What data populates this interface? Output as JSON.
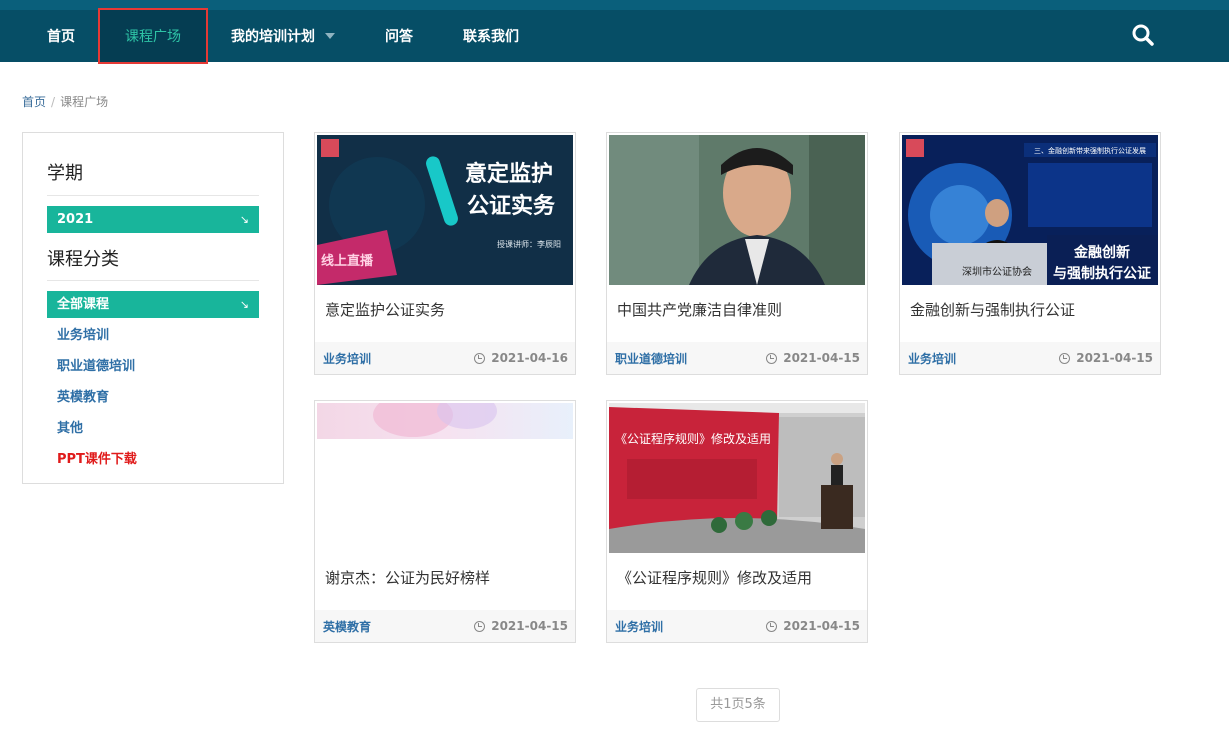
{
  "nav": {
    "items": [
      {
        "label": "首页"
      },
      {
        "label": "课程广场"
      },
      {
        "label": "我的培训计划"
      },
      {
        "label": "问答"
      },
      {
        "label": "联系我们"
      }
    ]
  },
  "breadcrumb": {
    "home": "首页",
    "current": "课程广场",
    "separator": "/"
  },
  "sidebar": {
    "term_title": "学期",
    "term_selected": "2021",
    "category_title": "课程分类",
    "category_selected": "全部课程",
    "categories": [
      "业务培训",
      "职业道德培训",
      "英模教育",
      "其他",
      "PPT课件下载"
    ]
  },
  "courses": [
    {
      "title": "意定监护公证实务",
      "category": "业务培训",
      "date": "2021-04-16",
      "thumb": {
        "headline1": "意定监护",
        "headline2": "公证实务",
        "lecturer": "授课讲师：李辰阳",
        "badge": "线上直播"
      }
    },
    {
      "title": "中国共产党廉洁自律准则",
      "category": "职业道德培训",
      "date": "2021-04-15"
    },
    {
      "title": "金融创新与强制执行公证",
      "category": "业务培训",
      "date": "2021-04-15",
      "thumb": {
        "header": "三、金融创新带来强制执行公证发展",
        "org": "深圳市公证协会",
        "caption1": "金融创新",
        "caption2": "与强制执行公证"
      }
    },
    {
      "title": "谢京杰：公证为民好榜样",
      "category": "英模教育",
      "date": "2021-04-15"
    },
    {
      "title": "《公证程序规则》修改及适用",
      "category": "业务培训",
      "date": "2021-04-15",
      "thumb": {
        "screen_title": "《公证程序规则》修改及适用"
      }
    }
  ],
  "pager": {
    "text": "共1页5条"
  },
  "colors": {
    "nav_bg": "#064e66",
    "accent": "#18b59b",
    "link": "#2f6fa6",
    "highlight_red": "#e01b1b"
  }
}
